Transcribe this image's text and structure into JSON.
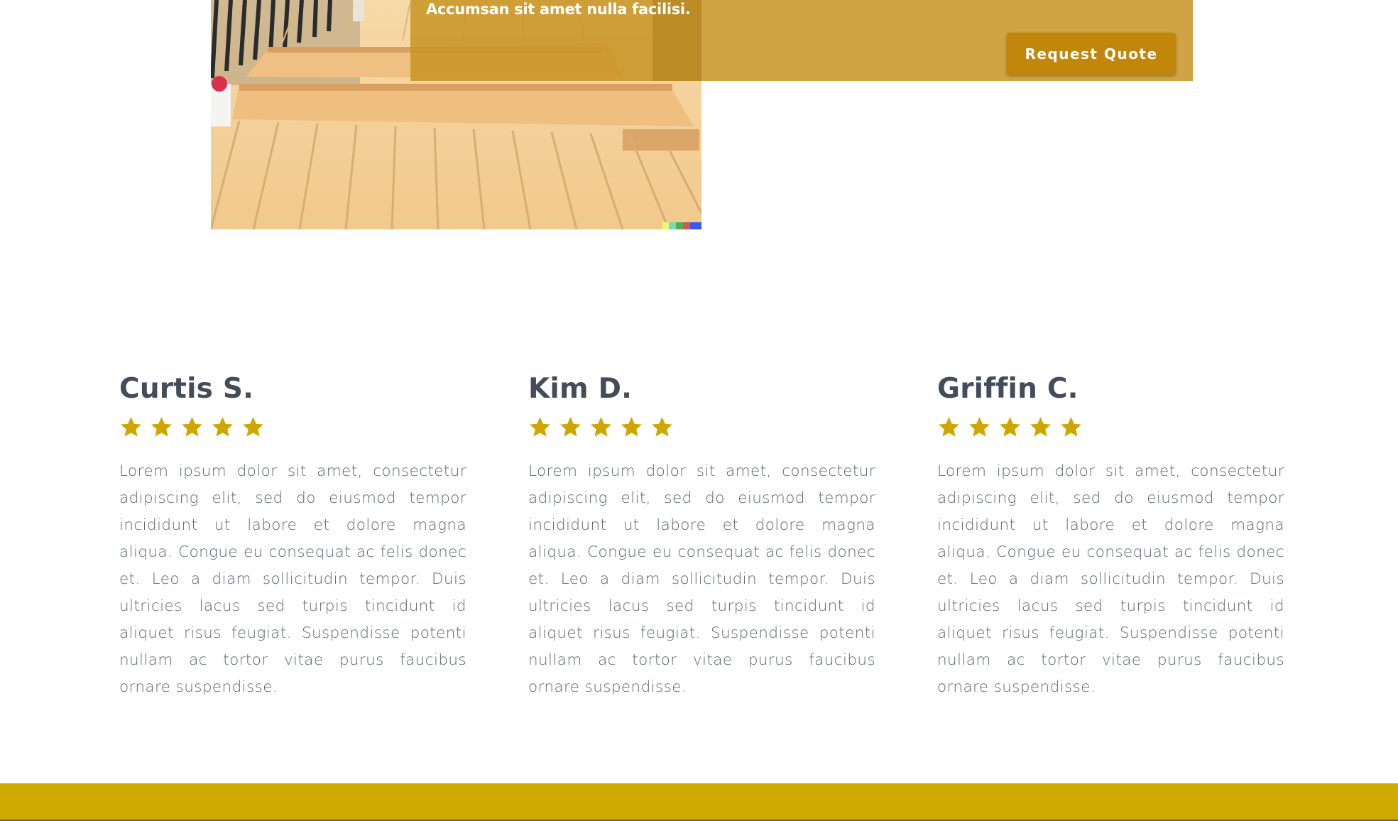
{
  "cta": {
    "text": "Accumsan sit amet nulla facilisi.",
    "button_label": "Request Quote"
  },
  "colors": {
    "accent": "#cfaa00",
    "banner": "#c8942a",
    "button": "#c1860a",
    "star": "#cfa500",
    "heading": "#444c5a",
    "body_text": "#5f6570"
  },
  "testimonials": [
    {
      "name": "Curtis S.",
      "rating": 5,
      "text": "Lorem ipsum dolor sit amet, consectetur adipiscing elit, sed do eiusmod tempor incididunt ut labore et dolore magna aliqua. Congue eu consequat ac felis donec et. Leo a diam sollicitudin tempor. Duis ultricies lacus sed turpis tincidunt id aliquet risus feugiat. Suspendisse potenti nullam ac tortor vitae purus faucibus ornare suspendisse."
    },
    {
      "name": "Kim D.",
      "rating": 5,
      "text": "Lorem ipsum dolor sit amet, consectetur adipiscing elit, sed do eiusmod tempor incididunt ut labore et dolore magna aliqua. Congue eu consequat ac felis donec et. Leo a diam sollicitudin tempor. Duis ultricies lacus sed turpis tincidunt id aliquet risus feugiat. Suspendisse potenti nullam ac tortor vitae purus faucibus ornare suspendisse."
    },
    {
      "name": "Griffin C.",
      "rating": 5,
      "text": "Lorem ipsum dolor sit amet, consectetur adipiscing elit, sed do eiusmod tempor incididunt ut labore et dolore magna aliqua. Congue eu consequat ac felis donec et. Leo a diam sollicitudin tempor. Duis ultricies lacus sed turpis tincidunt id aliquet risus feugiat. Suspendisse potenti nullam ac tortor vitae purus faucibus ornare suspendisse."
    }
  ]
}
